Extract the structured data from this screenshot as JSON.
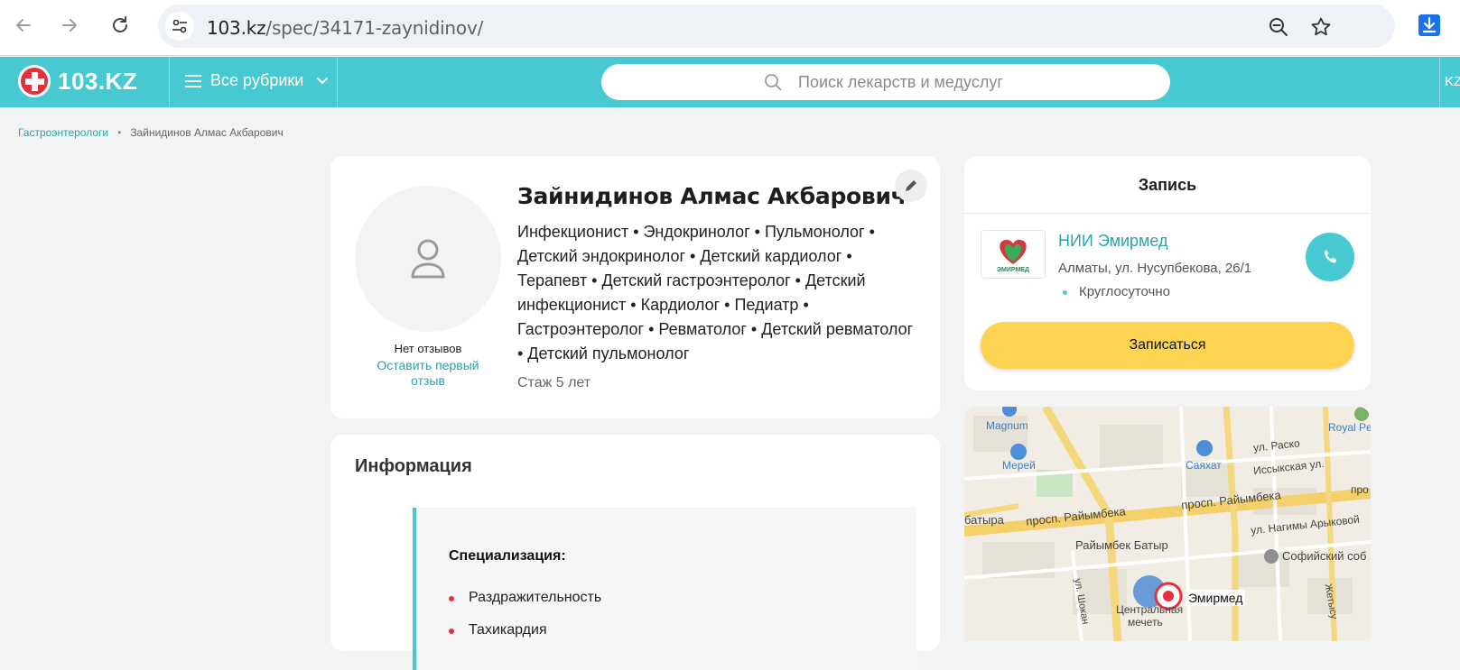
{
  "browser": {
    "url_host": "103.kz",
    "url_path": "/spec/34171-zaynidinov/"
  },
  "header": {
    "logo_text": "103.KZ",
    "rubrics_label": "Все рубрики",
    "search_placeholder": "Поиск лекарств и медуслуг",
    "lang": "KZ"
  },
  "breadcrumbs": [
    {
      "label": "Гастроэнтерологи"
    },
    {
      "label": "Зайнидинов Алмас Акбарович"
    }
  ],
  "profile": {
    "name": "Зайнидинов Алмас Акбарович",
    "specialties_text": "Инфекционист • Эндокринолог • Пульмонолог • Детский эндокринолог • Детский кардиолог • Терапевт • Детский гастроэнтеролог • Детский инфекционист • Кардиолог • Педиатр • Гастроэнтеролог • Ревматолог • Детский ревматолог • Детский пульмонолог",
    "experience": "Стаж 5 лет",
    "no_reviews": "Нет отзывов",
    "leave_review": "Оставить первый отзыв"
  },
  "info": {
    "title": "Информация",
    "spec_heading": "Специализация:",
    "items": [
      "Раздражительность",
      "Тахикардия"
    ]
  },
  "booking": {
    "title": "Запись",
    "clinic_name": "НИИ Эмирмед",
    "clinic_address": "Алматы, ул. Нусупбекова, 26/1",
    "clinic_hours": "Круглосуточно",
    "clinic_logo_text": "ЭМИРМЕД",
    "book_label": "Записаться"
  },
  "map": {
    "labels": {
      "magnum": "Magnum",
      "royal": "Royal Pe",
      "merey": "Мерей",
      "sayahat": "Саяхат",
      "issyk": "Иссыкская ул.",
      "pro": "про",
      "batyra": "батыра",
      "raiymbek1": "просп. Райымбека",
      "raiymbek2": "просп. Райымбека",
      "arykova": "ул. Нагимы Арыковой",
      "raiymbek_batyr": "Райымбек Батыр",
      "sofia": "Софийский соб",
      "central": "Центральная",
      "mosque": "мечеть",
      "raskova": "ул. Раско",
      "marker": "Эмирмед",
      "shokan": "ул. Шокан",
      "zhetysu": "Жетысу"
    }
  },
  "colors": {
    "brand": "#48c9d1",
    "brand_red": "#e4313b",
    "link": "#2aa3ad",
    "button_yellow": "#fcd452"
  }
}
